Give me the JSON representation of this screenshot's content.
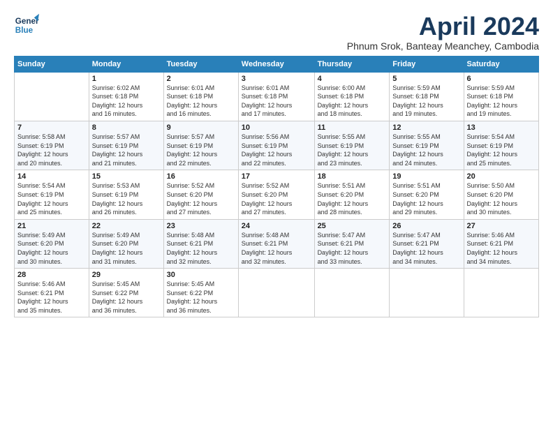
{
  "logo": {
    "line1": "General",
    "line2": "Blue"
  },
  "title": "April 2024",
  "location": "Phnum Srok, Banteay Meanchey, Cambodia",
  "days_of_week": [
    "Sunday",
    "Monday",
    "Tuesday",
    "Wednesday",
    "Thursday",
    "Friday",
    "Saturday"
  ],
  "weeks": [
    [
      {
        "day": "",
        "info": ""
      },
      {
        "day": "1",
        "info": "Sunrise: 6:02 AM\nSunset: 6:18 PM\nDaylight: 12 hours\nand 16 minutes."
      },
      {
        "day": "2",
        "info": "Sunrise: 6:01 AM\nSunset: 6:18 PM\nDaylight: 12 hours\nand 16 minutes."
      },
      {
        "day": "3",
        "info": "Sunrise: 6:01 AM\nSunset: 6:18 PM\nDaylight: 12 hours\nand 17 minutes."
      },
      {
        "day": "4",
        "info": "Sunrise: 6:00 AM\nSunset: 6:18 PM\nDaylight: 12 hours\nand 18 minutes."
      },
      {
        "day": "5",
        "info": "Sunrise: 5:59 AM\nSunset: 6:18 PM\nDaylight: 12 hours\nand 19 minutes."
      },
      {
        "day": "6",
        "info": "Sunrise: 5:59 AM\nSunset: 6:18 PM\nDaylight: 12 hours\nand 19 minutes."
      }
    ],
    [
      {
        "day": "7",
        "info": "Sunrise: 5:58 AM\nSunset: 6:19 PM\nDaylight: 12 hours\nand 20 minutes."
      },
      {
        "day": "8",
        "info": "Sunrise: 5:57 AM\nSunset: 6:19 PM\nDaylight: 12 hours\nand 21 minutes."
      },
      {
        "day": "9",
        "info": "Sunrise: 5:57 AM\nSunset: 6:19 PM\nDaylight: 12 hours\nand 22 minutes."
      },
      {
        "day": "10",
        "info": "Sunrise: 5:56 AM\nSunset: 6:19 PM\nDaylight: 12 hours\nand 22 minutes."
      },
      {
        "day": "11",
        "info": "Sunrise: 5:55 AM\nSunset: 6:19 PM\nDaylight: 12 hours\nand 23 minutes."
      },
      {
        "day": "12",
        "info": "Sunrise: 5:55 AM\nSunset: 6:19 PM\nDaylight: 12 hours\nand 24 minutes."
      },
      {
        "day": "13",
        "info": "Sunrise: 5:54 AM\nSunset: 6:19 PM\nDaylight: 12 hours\nand 25 minutes."
      }
    ],
    [
      {
        "day": "14",
        "info": "Sunrise: 5:54 AM\nSunset: 6:19 PM\nDaylight: 12 hours\nand 25 minutes."
      },
      {
        "day": "15",
        "info": "Sunrise: 5:53 AM\nSunset: 6:19 PM\nDaylight: 12 hours\nand 26 minutes."
      },
      {
        "day": "16",
        "info": "Sunrise: 5:52 AM\nSunset: 6:20 PM\nDaylight: 12 hours\nand 27 minutes."
      },
      {
        "day": "17",
        "info": "Sunrise: 5:52 AM\nSunset: 6:20 PM\nDaylight: 12 hours\nand 27 minutes."
      },
      {
        "day": "18",
        "info": "Sunrise: 5:51 AM\nSunset: 6:20 PM\nDaylight: 12 hours\nand 28 minutes."
      },
      {
        "day": "19",
        "info": "Sunrise: 5:51 AM\nSunset: 6:20 PM\nDaylight: 12 hours\nand 29 minutes."
      },
      {
        "day": "20",
        "info": "Sunrise: 5:50 AM\nSunset: 6:20 PM\nDaylight: 12 hours\nand 30 minutes."
      }
    ],
    [
      {
        "day": "21",
        "info": "Sunrise: 5:49 AM\nSunset: 6:20 PM\nDaylight: 12 hours\nand 30 minutes."
      },
      {
        "day": "22",
        "info": "Sunrise: 5:49 AM\nSunset: 6:20 PM\nDaylight: 12 hours\nand 31 minutes."
      },
      {
        "day": "23",
        "info": "Sunrise: 5:48 AM\nSunset: 6:21 PM\nDaylight: 12 hours\nand 32 minutes."
      },
      {
        "day": "24",
        "info": "Sunrise: 5:48 AM\nSunset: 6:21 PM\nDaylight: 12 hours\nand 32 minutes."
      },
      {
        "day": "25",
        "info": "Sunrise: 5:47 AM\nSunset: 6:21 PM\nDaylight: 12 hours\nand 33 minutes."
      },
      {
        "day": "26",
        "info": "Sunrise: 5:47 AM\nSunset: 6:21 PM\nDaylight: 12 hours\nand 34 minutes."
      },
      {
        "day": "27",
        "info": "Sunrise: 5:46 AM\nSunset: 6:21 PM\nDaylight: 12 hours\nand 34 minutes."
      }
    ],
    [
      {
        "day": "28",
        "info": "Sunrise: 5:46 AM\nSunset: 6:21 PM\nDaylight: 12 hours\nand 35 minutes."
      },
      {
        "day": "29",
        "info": "Sunrise: 5:45 AM\nSunset: 6:22 PM\nDaylight: 12 hours\nand 36 minutes."
      },
      {
        "day": "30",
        "info": "Sunrise: 5:45 AM\nSunset: 6:22 PM\nDaylight: 12 hours\nand 36 minutes."
      },
      {
        "day": "",
        "info": ""
      },
      {
        "day": "",
        "info": ""
      },
      {
        "day": "",
        "info": ""
      },
      {
        "day": "",
        "info": ""
      }
    ]
  ]
}
